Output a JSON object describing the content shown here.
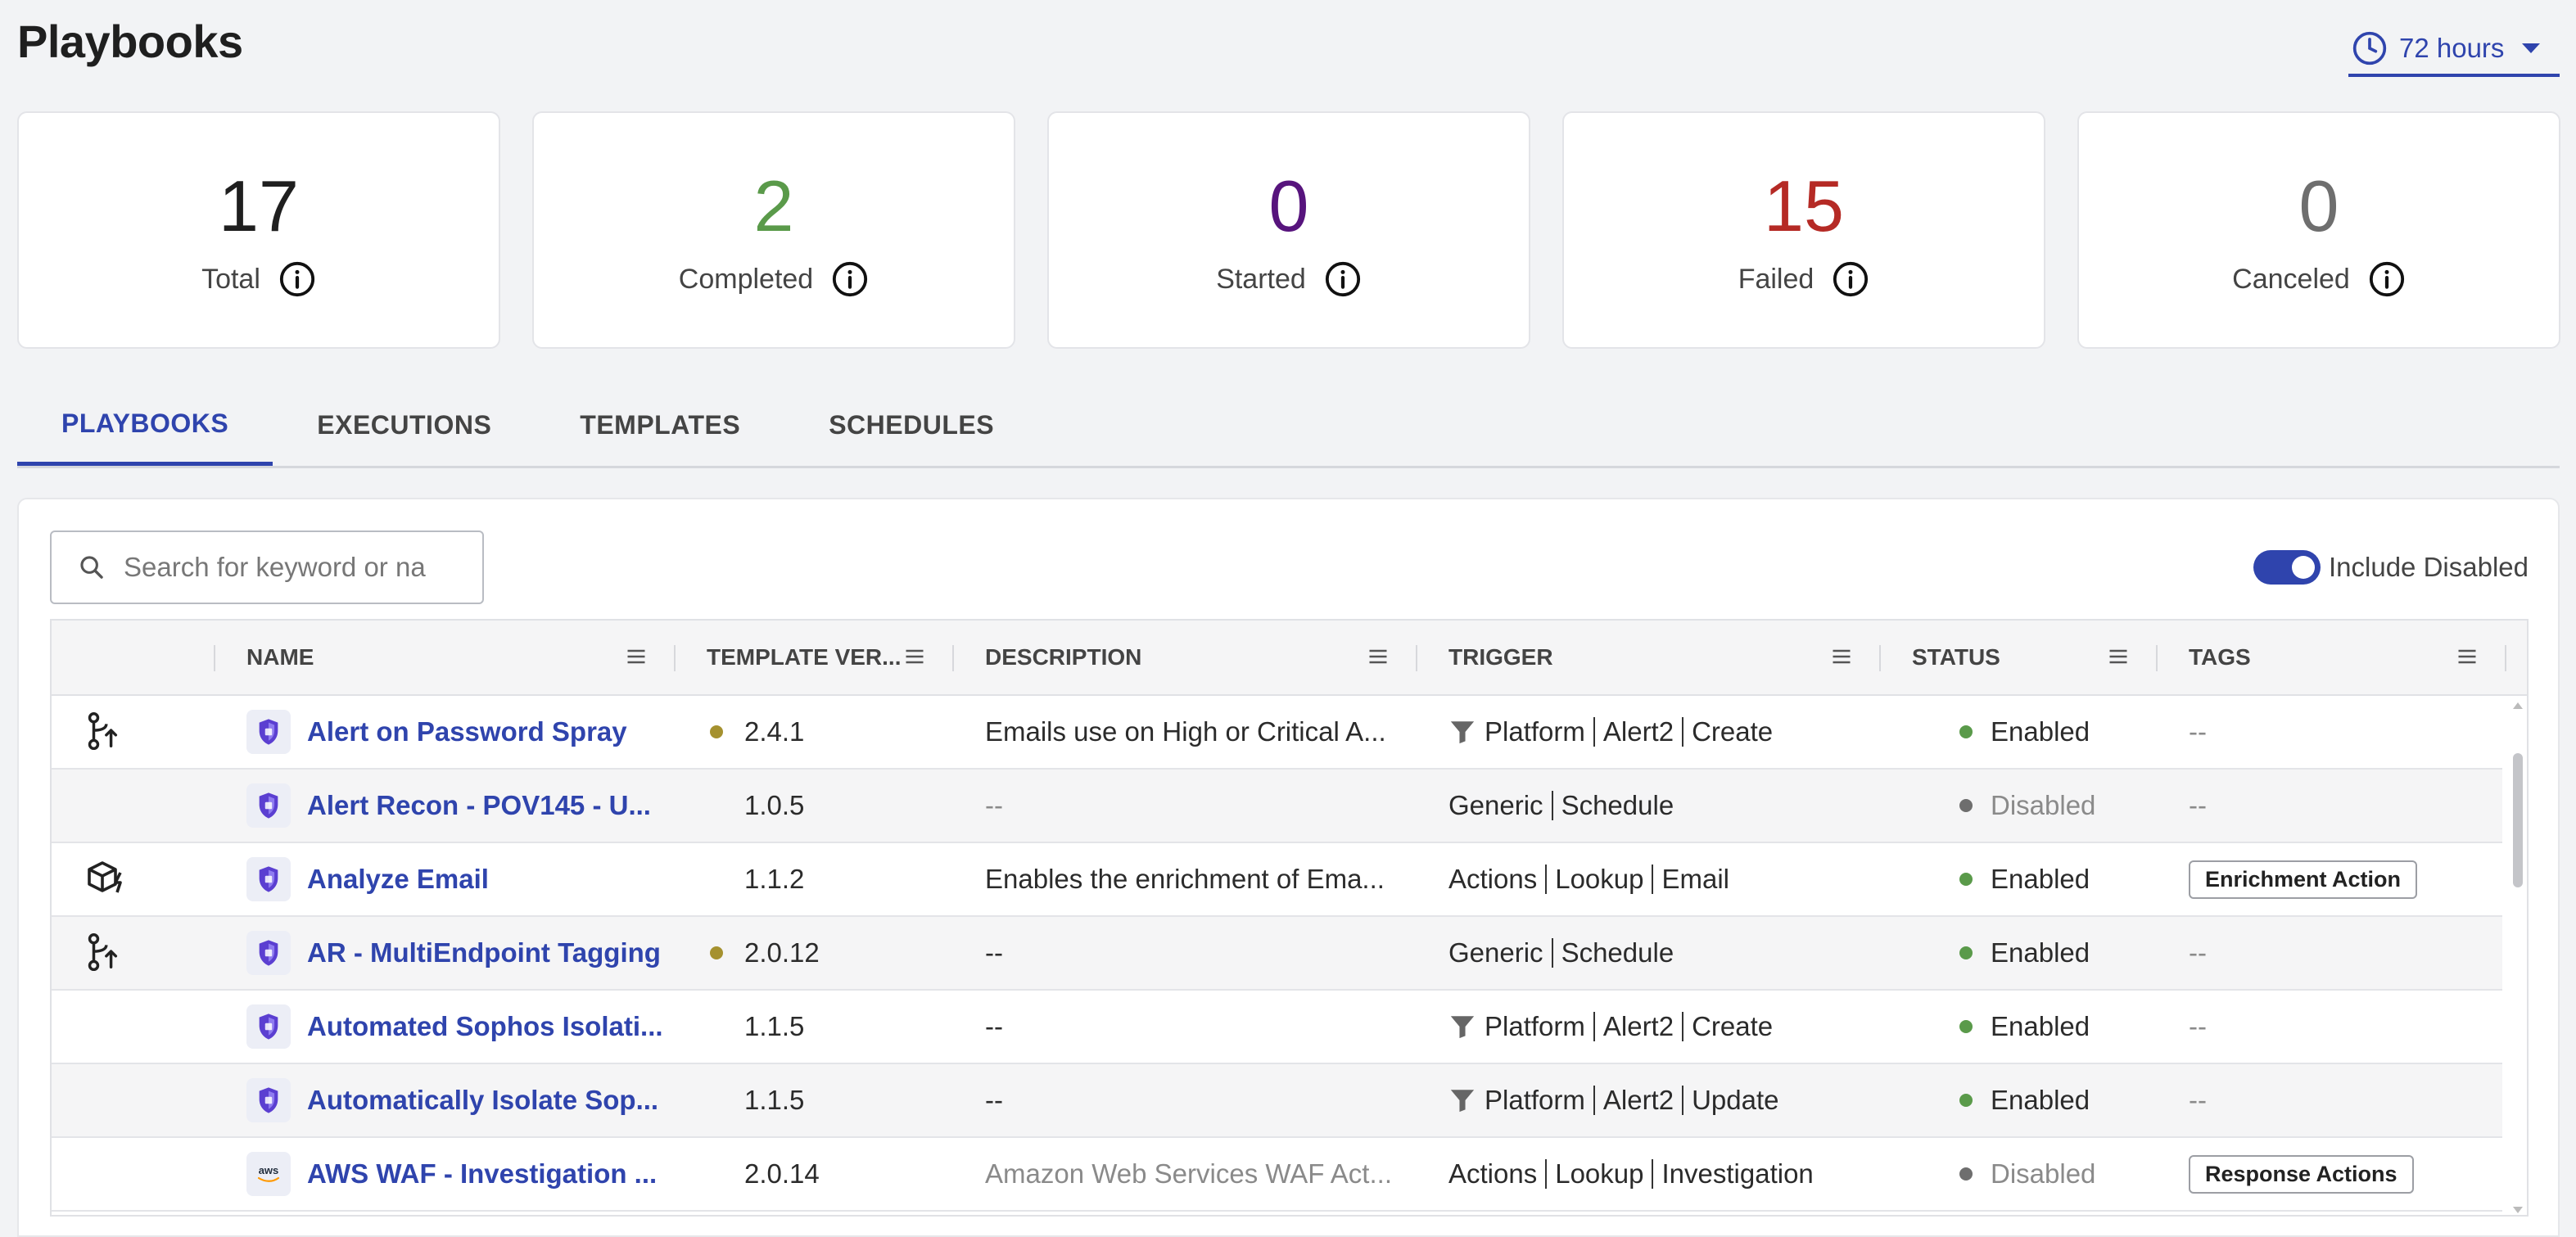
{
  "page": {
    "title": "Playbooks"
  },
  "time_picker": {
    "label": "72 hours"
  },
  "stats": [
    {
      "value": "17",
      "label": "Total",
      "color": "#1f1f1f"
    },
    {
      "value": "2",
      "label": "Completed",
      "color": "#5a9a4a"
    },
    {
      "value": "0",
      "label": "Started",
      "color": "#57147d"
    },
    {
      "value": "15",
      "label": "Failed",
      "color": "#b52a25"
    },
    {
      "value": "0",
      "label": "Canceled",
      "color": "#6e6e6e"
    }
  ],
  "tabs": [
    {
      "label": "PLAYBOOKS",
      "active": true
    },
    {
      "label": "EXECUTIONS",
      "active": false
    },
    {
      "label": "TEMPLATES",
      "active": false
    },
    {
      "label": "SCHEDULES",
      "active": false
    }
  ],
  "search": {
    "placeholder": "Search for keyword or na"
  },
  "include_disabled": {
    "label": "Include Disabled",
    "on": true
  },
  "columns": [
    "NAME",
    "TEMPLATE VER...",
    "DESCRIPTION",
    "TRIGGER",
    "STATUS",
    "TAGS"
  ],
  "colors": {
    "accent": "#2f44ad",
    "enabled": "#5a9a4a",
    "disabled": "#6e6e6e",
    "version_dot": "#a5912f"
  },
  "rows": [
    {
      "type_icon": "branch-arrow-icon",
      "name": "Alert on Password Spray",
      "version": "2.4.1",
      "version_dot": true,
      "description": "Emails use on High or Critical A...",
      "description_muted": false,
      "trigger_filter": true,
      "trigger": [
        "Platform",
        "Alert2",
        "Create"
      ],
      "status": "Enabled",
      "tag": "--"
    },
    {
      "type_icon": "",
      "name": "Alert Recon - POV145 - U...",
      "version": "1.0.5",
      "version_dot": false,
      "description": "--",
      "description_muted": true,
      "trigger_filter": false,
      "trigger": [
        "Generic",
        "Schedule"
      ],
      "status": "Disabled",
      "tag": "--"
    },
    {
      "type_icon": "cube-bolt-icon",
      "name": "Analyze Email",
      "version": "1.1.2",
      "version_dot": false,
      "description": "Enables the enrichment of Ema...",
      "description_muted": false,
      "trigger_filter": false,
      "trigger": [
        "Actions",
        "Lookup",
        "Email"
      ],
      "status": "Enabled",
      "tag": "Enrichment Action"
    },
    {
      "type_icon": "branch-arrow-icon",
      "name": "AR - MultiEndpoint Tagging",
      "version": "2.0.12",
      "version_dot": true,
      "description": "--",
      "description_muted": false,
      "trigger_filter": false,
      "trigger": [
        "Generic",
        "Schedule"
      ],
      "status": "Enabled",
      "tag": "--"
    },
    {
      "type_icon": "",
      "name": "Automated Sophos Isolati...",
      "version": "1.1.5",
      "version_dot": false,
      "description": "--",
      "description_muted": false,
      "trigger_filter": true,
      "trigger": [
        "Platform",
        "Alert2",
        "Create"
      ],
      "status": "Enabled",
      "tag": "--"
    },
    {
      "type_icon": "",
      "name": "Automatically Isolate Sop...",
      "version": "1.1.5",
      "version_dot": false,
      "description": "--",
      "description_muted": false,
      "trigger_filter": true,
      "trigger": [
        "Platform",
        "Alert2",
        "Update"
      ],
      "status": "Enabled",
      "tag": "--"
    },
    {
      "type_icon": "",
      "name": "AWS WAF - Investigation ...",
      "version": "2.0.14",
      "version_dot": false,
      "description": "Amazon Web Services WAF Act...",
      "description_muted": true,
      "trigger_filter": false,
      "trigger": [
        "Actions",
        "Lookup",
        "Investigation"
      ],
      "status": "Disabled",
      "tag": "Response Actions",
      "logo": "aws"
    }
  ]
}
